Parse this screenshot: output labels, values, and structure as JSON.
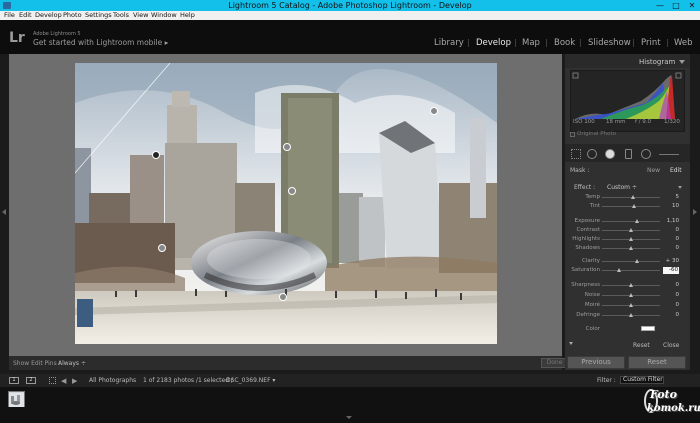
{
  "window": {
    "title": "Lightroom 5 Catalog - Adobe Photoshop Lightroom - Develop",
    "minimize": "—",
    "maximize": "□",
    "close": "✕"
  },
  "menu": [
    "File",
    "Edit",
    "Develop",
    "Photo",
    "Settings",
    "Tools",
    "View",
    "Window",
    "Help"
  ],
  "identity": {
    "logo": "Lr",
    "product": "Adobe Lightroom 5",
    "tagline": "Get started with Lightroom mobile ▸"
  },
  "modules": [
    {
      "label": "Library",
      "active": false
    },
    {
      "label": "Develop",
      "active": true
    },
    {
      "label": "Map",
      "active": false
    },
    {
      "label": "Book",
      "active": false
    },
    {
      "label": "Slideshow",
      "active": false
    },
    {
      "label": "Print",
      "active": false
    },
    {
      "label": "Web",
      "active": false
    }
  ],
  "toolbar": {
    "show_edit_pins_label": "Show Edit Pins :",
    "show_edit_pins_value": "Always ÷",
    "done": "Done"
  },
  "histogram": {
    "title": "Histogram",
    "iso": "ISO 100",
    "focal": "18 mm",
    "aperture": "f / 9.0",
    "shutter": "1/320",
    "original_photo": "Original Photo"
  },
  "mask": {
    "label": "Mask :",
    "new": "New",
    "edit": "Edit"
  },
  "effect": {
    "label": "Effect :",
    "value": "Custom ÷"
  },
  "sliders": [
    {
      "name": "Temp",
      "value": "5",
      "pos": 0.54
    },
    {
      "name": "Tint",
      "value": "10",
      "pos": 0.56
    },
    {
      "name": "Exposure",
      "value": "1,10",
      "pos": 0.6
    },
    {
      "name": "Contrast",
      "value": "0",
      "pos": 0.5
    },
    {
      "name": "Highlights",
      "value": "0",
      "pos": 0.5
    },
    {
      "name": "Shadows",
      "value": "0",
      "pos": 0.5
    },
    {
      "name": "Clarity",
      "value": "+ 30",
      "pos": 0.6
    },
    {
      "name": "Saturation",
      "value": "-60",
      "pos": 0.3
    },
    {
      "name": "Sharpness",
      "value": "0",
      "pos": 0.5
    },
    {
      "name": "Noise",
      "value": "0",
      "pos": 0.5
    },
    {
      "name": "Moiré",
      "value": "0",
      "pos": 0.5
    },
    {
      "name": "Defringe",
      "value": "0",
      "pos": 0.5
    }
  ],
  "color_label": "Color",
  "panel_actions": {
    "reset": "Reset",
    "close": "Close"
  },
  "bottom_buttons": {
    "previous": "Previous",
    "reset": "Reset"
  },
  "filmstrip": {
    "monitor1": "1",
    "monitor2": "2",
    "source": "All Photographs",
    "info": "1 of 2183 photos /1 selected /",
    "filename": "DSC_0369.NEF ▾",
    "filter_label": "Filter :",
    "filter_value": "Custom Filter"
  },
  "watermark": {
    "line1": "Foto",
    "line2": "komok.ru"
  }
}
